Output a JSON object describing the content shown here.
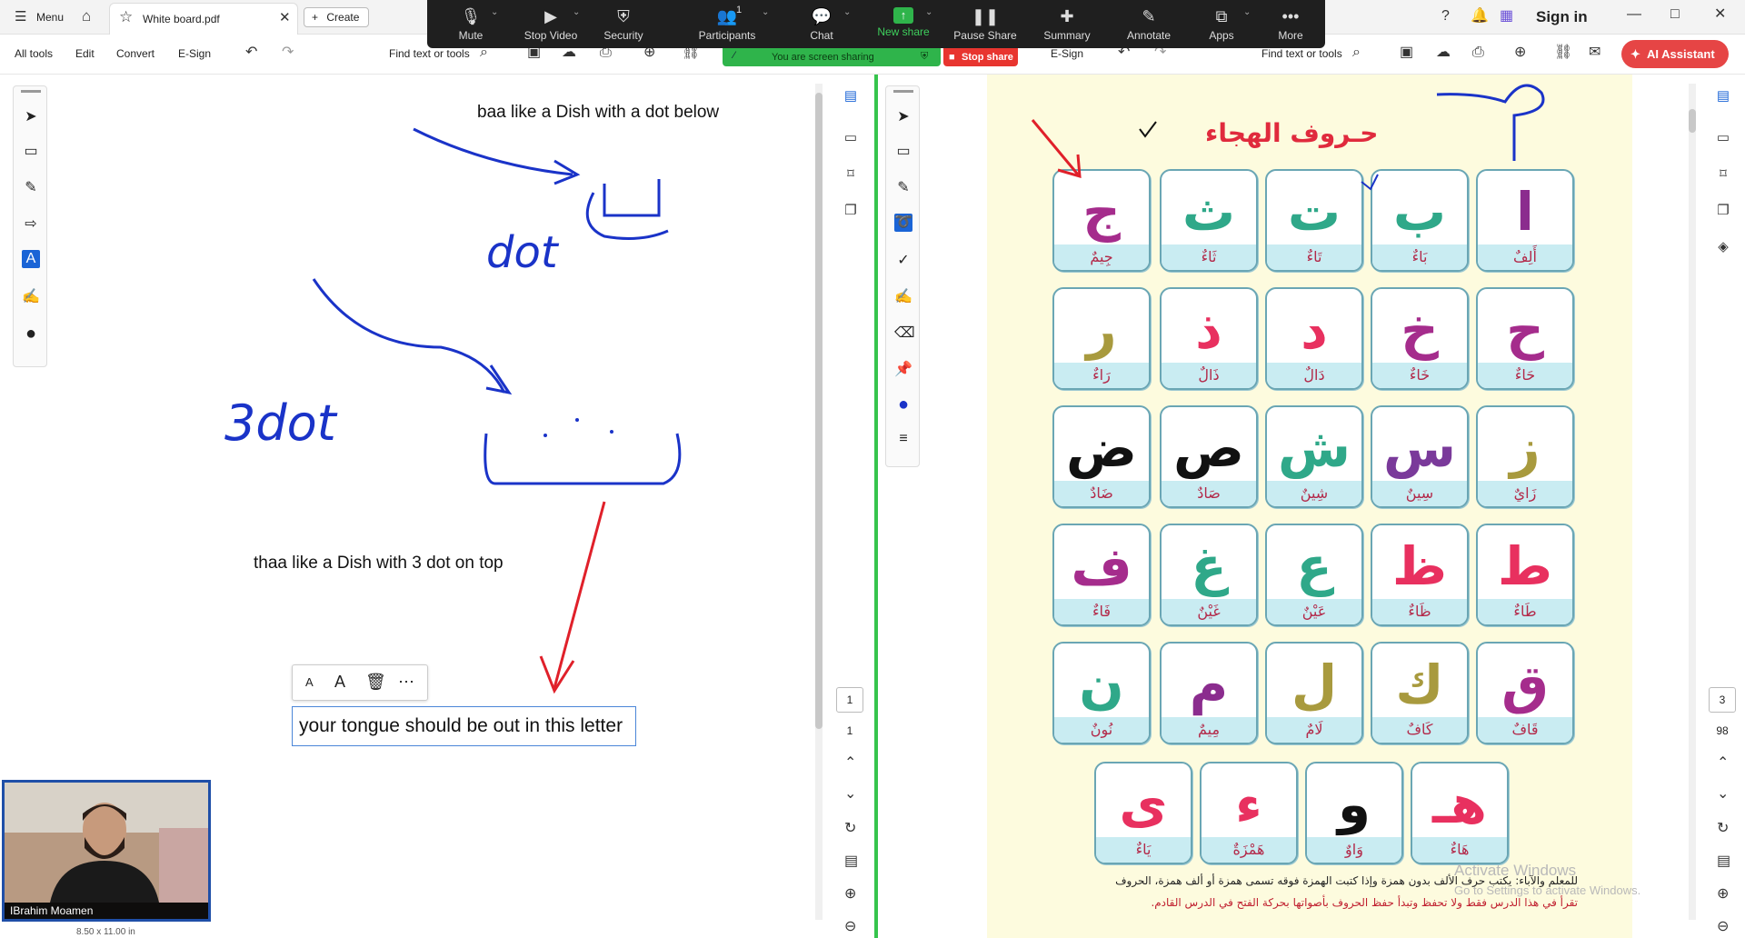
{
  "app": {
    "menu_label": "Menu",
    "tab_title": "White board.pdf",
    "create_label": "Create",
    "sign_in": "Sign in"
  },
  "toolbar": {
    "all_tools": "All tools",
    "edit": "Edit",
    "convert": "Convert",
    "esign": "E-Sign",
    "find_text": "Find text or tools",
    "ai_assistant": "AI Assistant",
    "right_esign": "E-Sign",
    "right_find_text": "Find text or tools"
  },
  "zoom": {
    "mute": "Mute",
    "stop_video": "Stop Video",
    "security": "Security",
    "participants": "Participants",
    "participants_count": "1",
    "chat": "Chat",
    "new_share": "New share",
    "pause_share": "Pause Share",
    "summary": "Summary",
    "annotate": "Annotate",
    "apps": "Apps",
    "more": "More",
    "sharing_status": "You are screen sharing",
    "stop_share": "Stop share"
  },
  "whiteboard": {
    "note1": "baa like a Dish with a dot below",
    "handwriting_dot": "dot",
    "handwriting_3dot": "3dot",
    "note2": "thaa like a Dish with 3 dot on top",
    "textbox": "your tongue should be out in this letter",
    "page_current": "1",
    "page_total": "1",
    "page_size": "8.50 x 11.00 in"
  },
  "alphabet_page": {
    "title": "حـروف الهجاء",
    "page_current": "3",
    "page_total": "98",
    "letters": [
      {
        "letter": "ا",
        "name": "أَلِفٌ",
        "color": "#8b2c8e"
      },
      {
        "letter": "ب",
        "name": "بَاءٌ",
        "color": "#2fa889"
      },
      {
        "letter": "ت",
        "name": "تَاءٌ",
        "color": "#2fa889"
      },
      {
        "letter": "ث",
        "name": "ثَاءٌ",
        "color": "#2fa889"
      },
      {
        "letter": "ج",
        "name": "جِيمٌ",
        "color": "#a52c8c"
      },
      {
        "letter": "ح",
        "name": "حَاءٌ",
        "color": "#a52c8c"
      },
      {
        "letter": "خ",
        "name": "خَاءٌ",
        "color": "#a52c8c"
      },
      {
        "letter": "د",
        "name": "دَالٌ",
        "color": "#e8305f"
      },
      {
        "letter": "ذ",
        "name": "ذَالٌ",
        "color": "#e8305f"
      },
      {
        "letter": "ر",
        "name": "رَاءٌ",
        "color": "#a89a3e"
      },
      {
        "letter": "ز",
        "name": "زَايٌ",
        "color": "#a89a3e"
      },
      {
        "letter": "س",
        "name": "سِينٌ",
        "color": "#7a3a9a"
      },
      {
        "letter": "ش",
        "name": "شِينٌ",
        "color": "#2fa889"
      },
      {
        "letter": "ص",
        "name": "صَادٌ",
        "color": "#111111"
      },
      {
        "letter": "ض",
        "name": "ضَادٌ",
        "color": "#111111"
      },
      {
        "letter": "ط",
        "name": "طَاءٌ",
        "color": "#e8305f"
      },
      {
        "letter": "ظ",
        "name": "ظَاءٌ",
        "color": "#e8305f"
      },
      {
        "letter": "ع",
        "name": "عَيْنٌ",
        "color": "#2fa889"
      },
      {
        "letter": "غ",
        "name": "غَيْنٌ",
        "color": "#2fa889"
      },
      {
        "letter": "ف",
        "name": "فَاءٌ",
        "color": "#a52c8c"
      },
      {
        "letter": "ق",
        "name": "قَافٌ",
        "color": "#a52c8c"
      },
      {
        "letter": "ك",
        "name": "كَافٌ",
        "color": "#a89a3e"
      },
      {
        "letter": "ل",
        "name": "لَامٌ",
        "color": "#a89a3e"
      },
      {
        "letter": "م",
        "name": "مِيمٌ",
        "color": "#8b2c8e"
      },
      {
        "letter": "ن",
        "name": "نُونٌ",
        "color": "#2fa889"
      },
      {
        "letter": "هـ",
        "name": "هَاءٌ",
        "color": "#e8305f"
      },
      {
        "letter": "و",
        "name": "وَاوٌ",
        "color": "#111111"
      },
      {
        "letter": "ء",
        "name": "هَمْزَةٌ",
        "color": "#e8305f"
      },
      {
        "letter": "ى",
        "name": "يَاءٌ",
        "color": "#e8305f"
      }
    ],
    "footer_line1": "للمعلم والآباء: يكتب حرف الألف بدون همزة وإذا كتبت الهمزة فوقه تسمى همزة أو ألف همزة، الحروف",
    "footer_line2": "تقرأ في هذا الدرس فقط ولا تحفظ وتبدأ حفظ الحروف بأصواتها بحركة الفتح في الدرس القادم."
  },
  "participant": {
    "name": "IBrahim Moamen"
  },
  "watermark": {
    "title": "Activate Windows",
    "subtitle": "Go to Settings to activate Windows."
  }
}
